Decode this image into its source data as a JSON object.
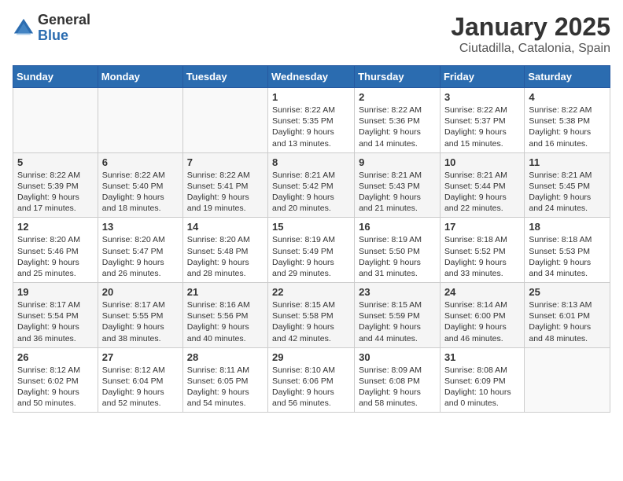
{
  "logo": {
    "general": "General",
    "blue": "Blue"
  },
  "title": "January 2025",
  "subtitle": "Ciutadilla, Catalonia, Spain",
  "headers": [
    "Sunday",
    "Monday",
    "Tuesday",
    "Wednesday",
    "Thursday",
    "Friday",
    "Saturday"
  ],
  "weeks": [
    [
      {
        "day": "",
        "info": ""
      },
      {
        "day": "",
        "info": ""
      },
      {
        "day": "",
        "info": ""
      },
      {
        "day": "1",
        "info": "Sunrise: 8:22 AM\nSunset: 5:35 PM\nDaylight: 9 hours\nand 13 minutes."
      },
      {
        "day": "2",
        "info": "Sunrise: 8:22 AM\nSunset: 5:36 PM\nDaylight: 9 hours\nand 14 minutes."
      },
      {
        "day": "3",
        "info": "Sunrise: 8:22 AM\nSunset: 5:37 PM\nDaylight: 9 hours\nand 15 minutes."
      },
      {
        "day": "4",
        "info": "Sunrise: 8:22 AM\nSunset: 5:38 PM\nDaylight: 9 hours\nand 16 minutes."
      }
    ],
    [
      {
        "day": "5",
        "info": "Sunrise: 8:22 AM\nSunset: 5:39 PM\nDaylight: 9 hours\nand 17 minutes."
      },
      {
        "day": "6",
        "info": "Sunrise: 8:22 AM\nSunset: 5:40 PM\nDaylight: 9 hours\nand 18 minutes."
      },
      {
        "day": "7",
        "info": "Sunrise: 8:22 AM\nSunset: 5:41 PM\nDaylight: 9 hours\nand 19 minutes."
      },
      {
        "day": "8",
        "info": "Sunrise: 8:21 AM\nSunset: 5:42 PM\nDaylight: 9 hours\nand 20 minutes."
      },
      {
        "day": "9",
        "info": "Sunrise: 8:21 AM\nSunset: 5:43 PM\nDaylight: 9 hours\nand 21 minutes."
      },
      {
        "day": "10",
        "info": "Sunrise: 8:21 AM\nSunset: 5:44 PM\nDaylight: 9 hours\nand 22 minutes."
      },
      {
        "day": "11",
        "info": "Sunrise: 8:21 AM\nSunset: 5:45 PM\nDaylight: 9 hours\nand 24 minutes."
      }
    ],
    [
      {
        "day": "12",
        "info": "Sunrise: 8:20 AM\nSunset: 5:46 PM\nDaylight: 9 hours\nand 25 minutes."
      },
      {
        "day": "13",
        "info": "Sunrise: 8:20 AM\nSunset: 5:47 PM\nDaylight: 9 hours\nand 26 minutes."
      },
      {
        "day": "14",
        "info": "Sunrise: 8:20 AM\nSunset: 5:48 PM\nDaylight: 9 hours\nand 28 minutes."
      },
      {
        "day": "15",
        "info": "Sunrise: 8:19 AM\nSunset: 5:49 PM\nDaylight: 9 hours\nand 29 minutes."
      },
      {
        "day": "16",
        "info": "Sunrise: 8:19 AM\nSunset: 5:50 PM\nDaylight: 9 hours\nand 31 minutes."
      },
      {
        "day": "17",
        "info": "Sunrise: 8:18 AM\nSunset: 5:52 PM\nDaylight: 9 hours\nand 33 minutes."
      },
      {
        "day": "18",
        "info": "Sunrise: 8:18 AM\nSunset: 5:53 PM\nDaylight: 9 hours\nand 34 minutes."
      }
    ],
    [
      {
        "day": "19",
        "info": "Sunrise: 8:17 AM\nSunset: 5:54 PM\nDaylight: 9 hours\nand 36 minutes."
      },
      {
        "day": "20",
        "info": "Sunrise: 8:17 AM\nSunset: 5:55 PM\nDaylight: 9 hours\nand 38 minutes."
      },
      {
        "day": "21",
        "info": "Sunrise: 8:16 AM\nSunset: 5:56 PM\nDaylight: 9 hours\nand 40 minutes."
      },
      {
        "day": "22",
        "info": "Sunrise: 8:15 AM\nSunset: 5:58 PM\nDaylight: 9 hours\nand 42 minutes."
      },
      {
        "day": "23",
        "info": "Sunrise: 8:15 AM\nSunset: 5:59 PM\nDaylight: 9 hours\nand 44 minutes."
      },
      {
        "day": "24",
        "info": "Sunrise: 8:14 AM\nSunset: 6:00 PM\nDaylight: 9 hours\nand 46 minutes."
      },
      {
        "day": "25",
        "info": "Sunrise: 8:13 AM\nSunset: 6:01 PM\nDaylight: 9 hours\nand 48 minutes."
      }
    ],
    [
      {
        "day": "26",
        "info": "Sunrise: 8:12 AM\nSunset: 6:02 PM\nDaylight: 9 hours\nand 50 minutes."
      },
      {
        "day": "27",
        "info": "Sunrise: 8:12 AM\nSunset: 6:04 PM\nDaylight: 9 hours\nand 52 minutes."
      },
      {
        "day": "28",
        "info": "Sunrise: 8:11 AM\nSunset: 6:05 PM\nDaylight: 9 hours\nand 54 minutes."
      },
      {
        "day": "29",
        "info": "Sunrise: 8:10 AM\nSunset: 6:06 PM\nDaylight: 9 hours\nand 56 minutes."
      },
      {
        "day": "30",
        "info": "Sunrise: 8:09 AM\nSunset: 6:08 PM\nDaylight: 9 hours\nand 58 minutes."
      },
      {
        "day": "31",
        "info": "Sunrise: 8:08 AM\nSunset: 6:09 PM\nDaylight: 10 hours\nand 0 minutes."
      },
      {
        "day": "",
        "info": ""
      }
    ]
  ]
}
